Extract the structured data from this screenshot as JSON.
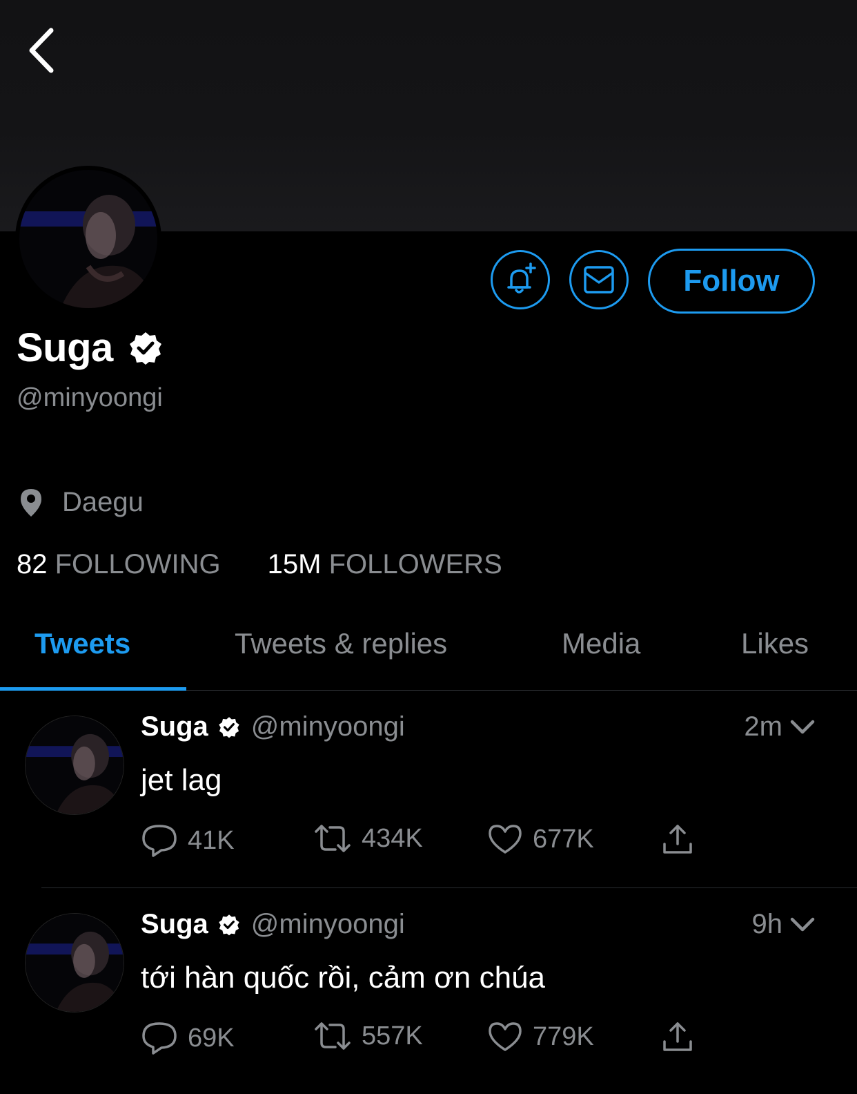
{
  "profile": {
    "display_name": "Suga",
    "handle": "@minyoongi",
    "location": "Daegu",
    "following_count": "82",
    "following_label": "FOLLOWING",
    "followers_count": "15M",
    "followers_label": "FOLLOWERS",
    "follow_label": "Follow"
  },
  "tabs": [
    {
      "label": "Tweets",
      "active": true
    },
    {
      "label": "Tweets & replies",
      "active": false
    },
    {
      "label": "Media",
      "active": false
    },
    {
      "label": "Likes",
      "active": false
    }
  ],
  "tweets": [
    {
      "name": "Suga",
      "handle": "@minyoongi",
      "time": "2m",
      "text": "jet lag",
      "replies": "41K",
      "retweets": "434K",
      "likes": "677K"
    },
    {
      "name": "Suga",
      "handle": "@minyoongi",
      "time": "9h",
      "text": "tới hàn quốc rồi, cảm ơn chúa",
      "replies": "69K",
      "retweets": "557K",
      "likes": "779K"
    }
  ],
  "colors": {
    "accent": "#1d9bf0",
    "background": "#000000",
    "secondary_text": "#8a8d91"
  },
  "icons": {
    "back": "chevron-left-icon",
    "notify": "bell-plus-icon",
    "message": "envelope-icon",
    "verified": "verified-badge-icon",
    "location": "location-pin-icon",
    "reply": "reply-bubble-icon",
    "retweet": "retweet-icon",
    "like": "heart-icon",
    "share": "share-icon",
    "caret": "chevron-down-icon"
  }
}
